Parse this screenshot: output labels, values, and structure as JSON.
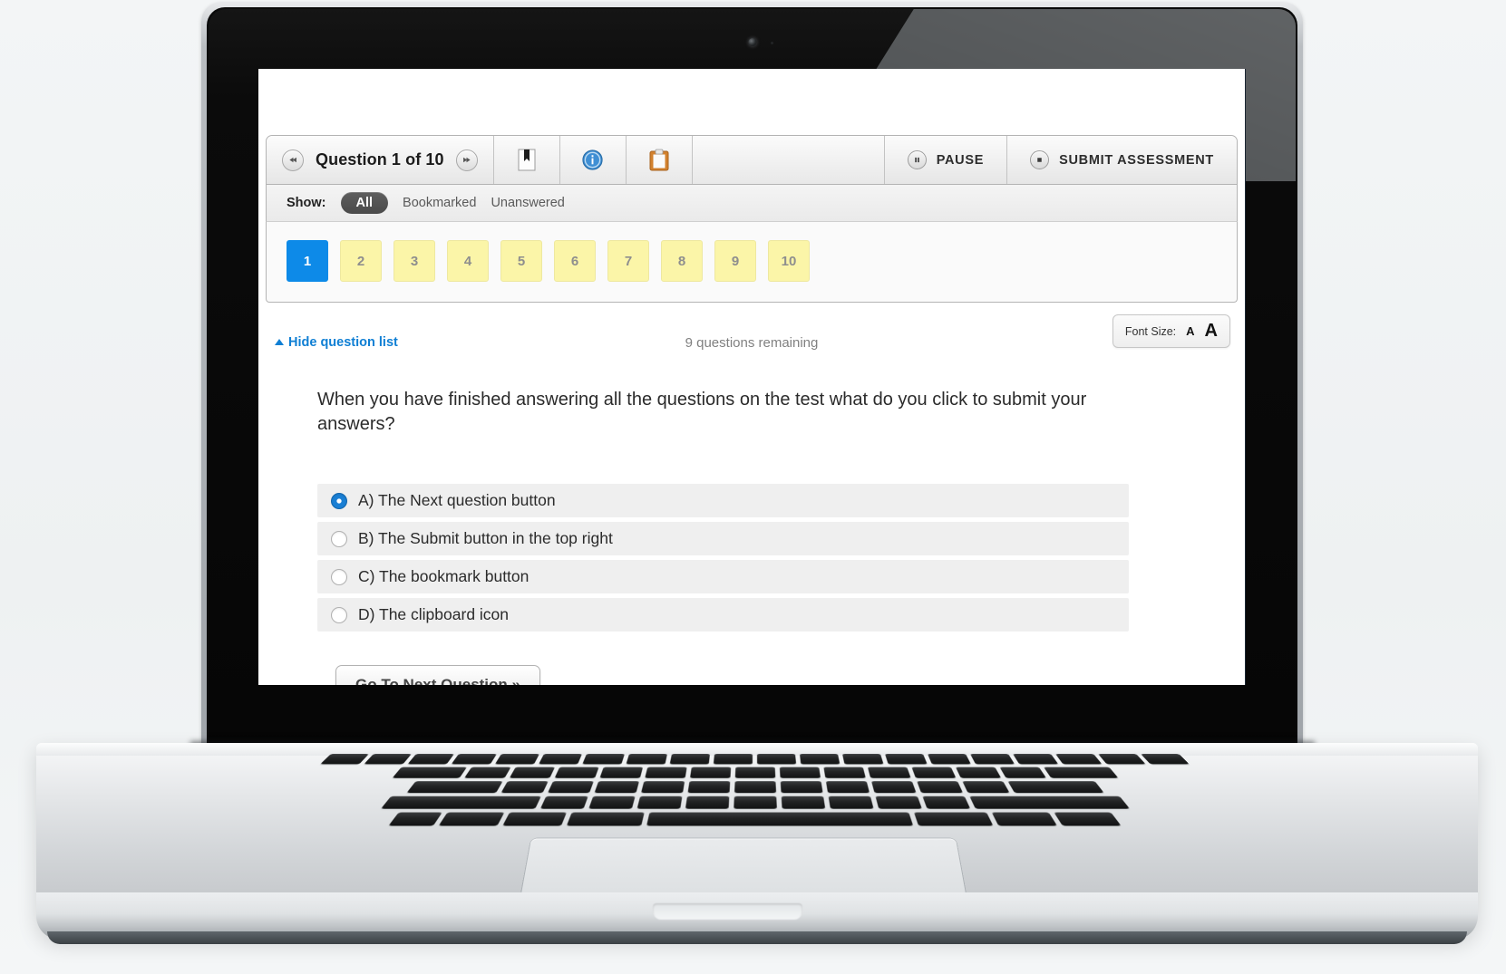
{
  "device": {
    "name": "laptop-macbook-pro",
    "webcam": "webcam-icon"
  },
  "toolbar": {
    "prev_label": "◀◀",
    "next_label": "▶▶",
    "question_title": "Question 1 of 10",
    "bookmark_icon": "bookmark-icon",
    "info_icon": "info-icon",
    "clipboard_icon": "clipboard-icon",
    "pause_label": "PAUSE",
    "submit_label": "SUBMIT ASSESSMENT"
  },
  "filter_bar": {
    "show_label": "Show:",
    "options": [
      "All",
      "Bookmarked",
      "Unanswered"
    ],
    "selected": "All"
  },
  "question_tiles": {
    "items": [
      "1",
      "2",
      "3",
      "4",
      "5",
      "6",
      "7",
      "8",
      "9",
      "10"
    ],
    "current": "1",
    "current_color": "#0d8ae8",
    "tile_color": "#fbf5a8"
  },
  "meta": {
    "hide_list_label": "Hide question list",
    "hide_list_color": "#0f7fd4",
    "remaining_label": "9 questions remaining",
    "font_size_label": "Font Size:",
    "font_small": "A",
    "font_large": "A"
  },
  "question": {
    "text": "When you have finished answering all the questions on the test what do you click to submit your answers?",
    "options": [
      {
        "label": "A) The Next question button",
        "selected": true
      },
      {
        "label": "B)  The Submit button in the top right",
        "selected": false
      },
      {
        "label": "C) The bookmark button",
        "selected": false
      },
      {
        "label": "D) The clipboard icon",
        "selected": false
      }
    ]
  },
  "footer": {
    "next_question_label": "Go To Next Question »"
  }
}
